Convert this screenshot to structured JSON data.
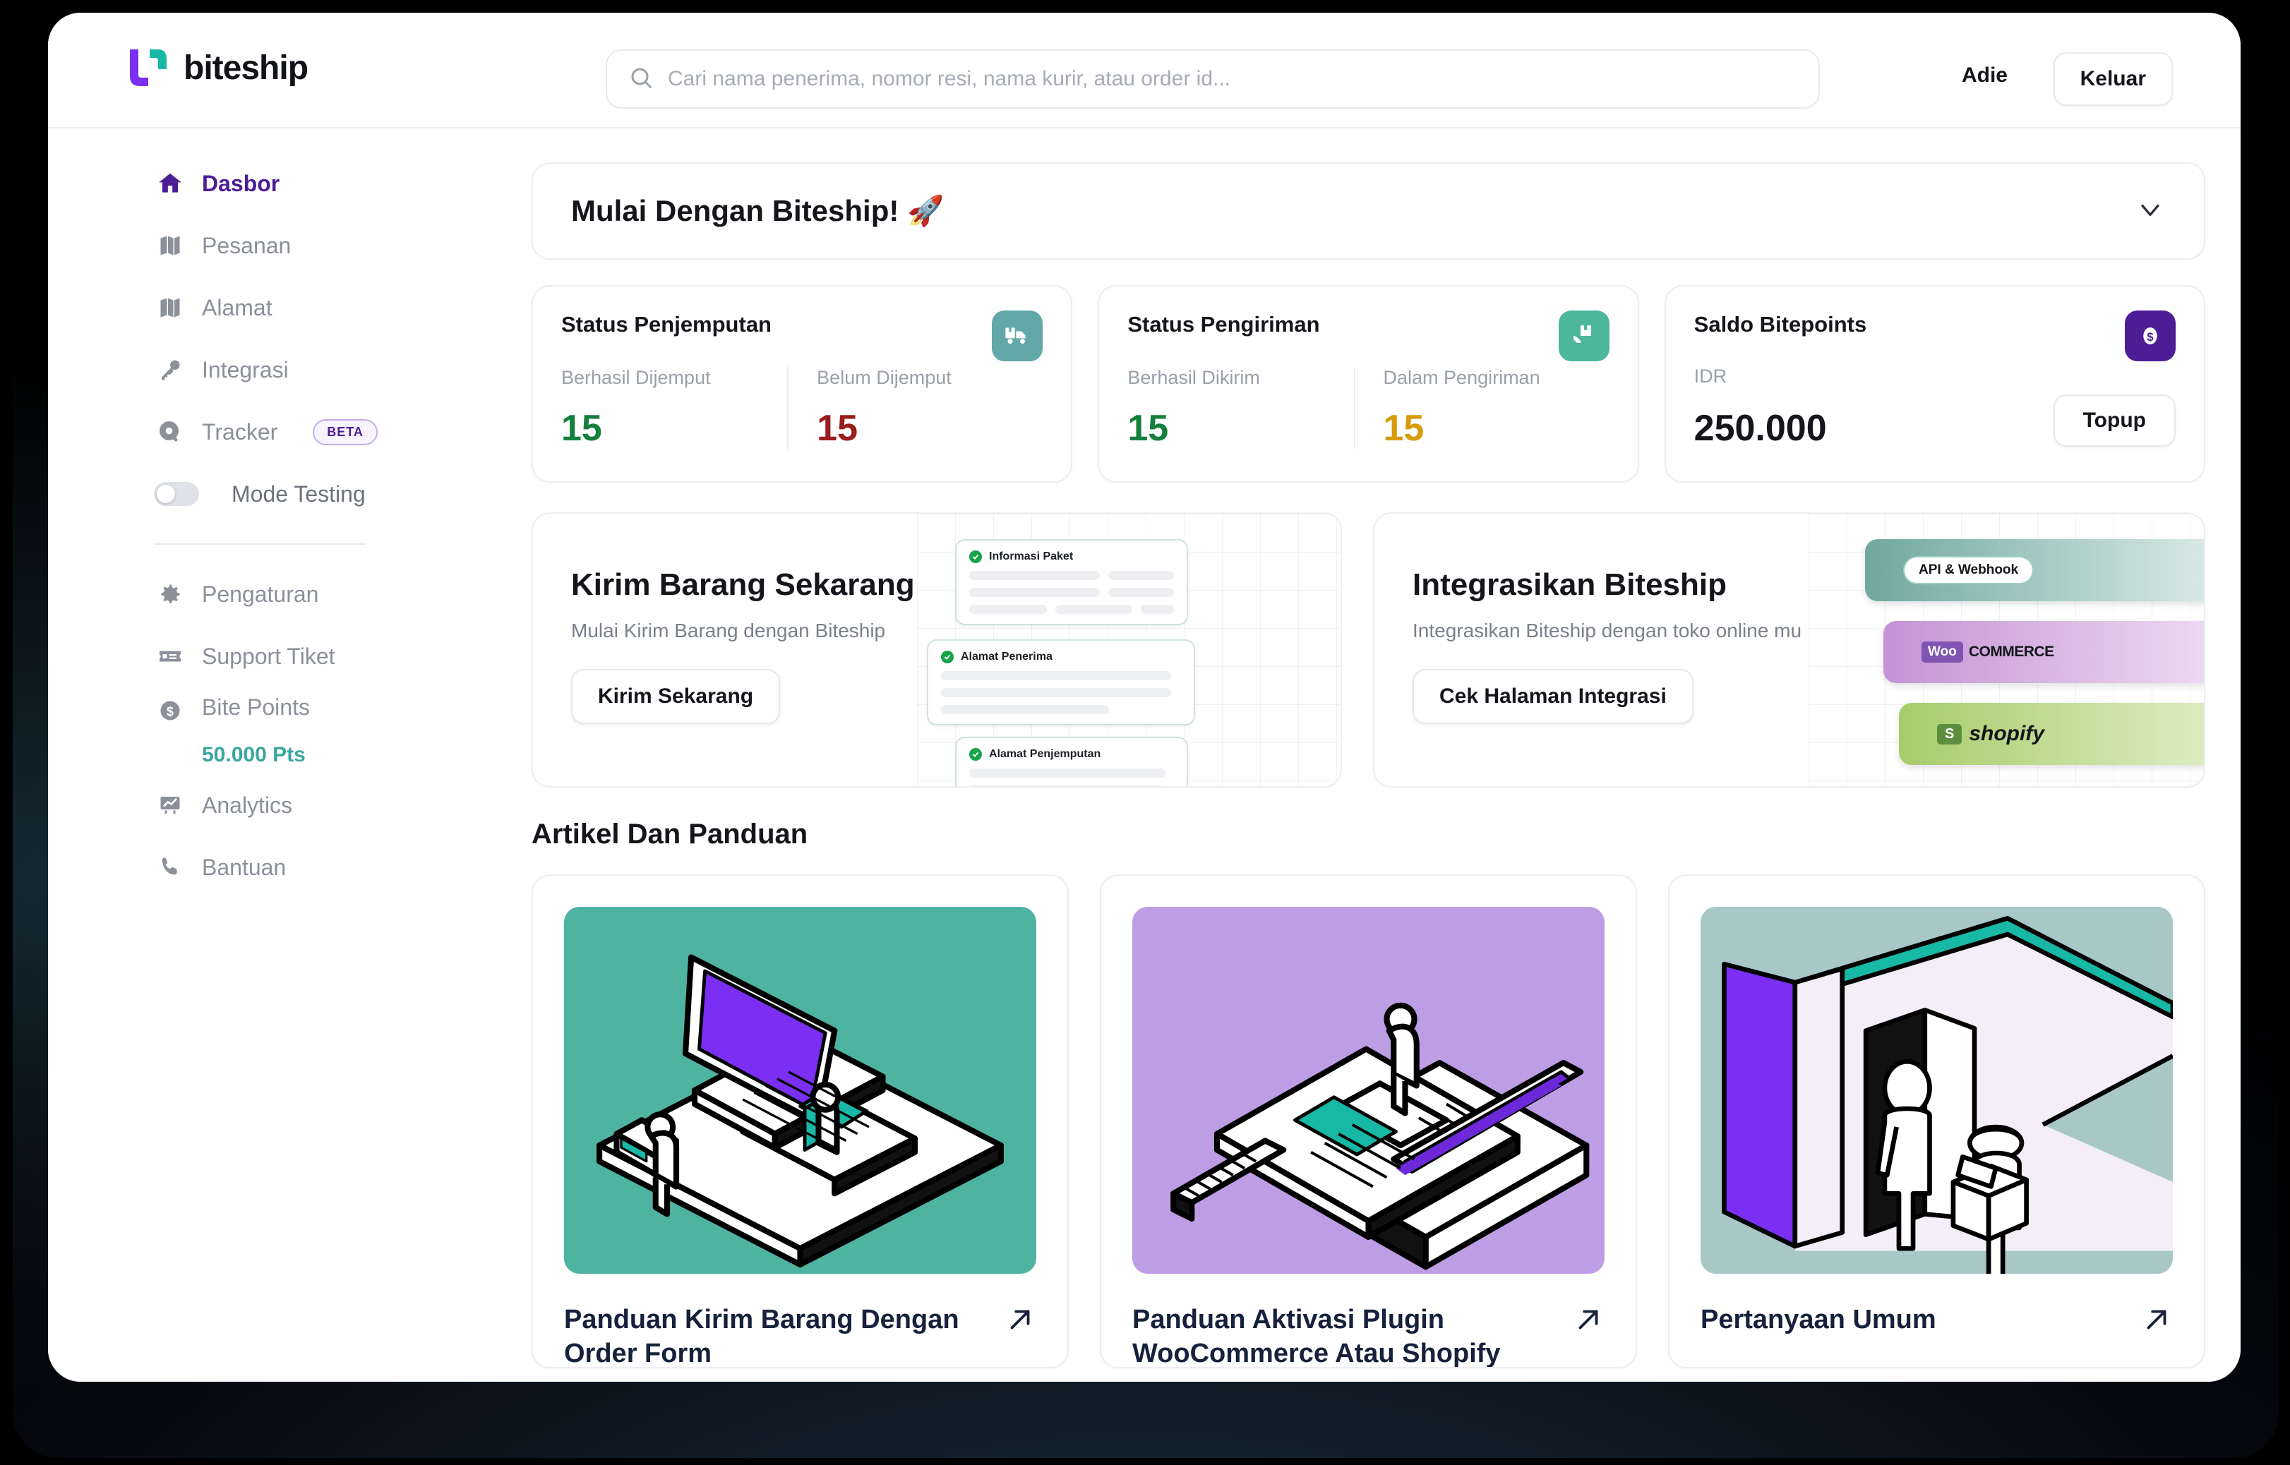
{
  "header": {
    "logo_text": "biteship",
    "logo_purple": "#7b2ff2",
    "logo_teal": "#17b8a6",
    "search_placeholder": "Cari nama penerima, nomor resi, nama kurir, atau order id...",
    "search_value": "",
    "user_name": "Adie",
    "logout_label": "Keluar"
  },
  "sidebar": {
    "items": [
      {
        "label": "Dasbor",
        "icon": "home-icon",
        "active": true
      },
      {
        "label": "Pesanan",
        "icon": "map-icon",
        "active": false
      },
      {
        "label": "Alamat",
        "icon": "map-icon",
        "active": false
      },
      {
        "label": "Integrasi",
        "icon": "key-icon",
        "active": false
      },
      {
        "label": "Tracker",
        "icon": "search-circle-icon",
        "active": false,
        "badge": "BETA"
      }
    ],
    "toggle": {
      "label": "Mode Testing",
      "state": "off"
    },
    "items2": [
      {
        "label": "Pengaturan",
        "icon": "gear-icon"
      },
      {
        "label": "Support Tiket",
        "icon": "ticket-icon"
      },
      {
        "label": "Bite Points",
        "icon": "money-icon",
        "sub": "50.000 Pts",
        "sub_color": "#3aa6a0"
      },
      {
        "label": "Analytics",
        "icon": "chart-icon"
      },
      {
        "label": "Bantuan",
        "icon": "phone-icon"
      }
    ]
  },
  "main": {
    "onboarding": {
      "title": "Mulai Dengan Biteship! 🚀",
      "chevron": "chevron-down-icon"
    },
    "stats": [
      {
        "title": "Status Penjemputan",
        "badge_icon": "truck-box-icon",
        "badge_color": "#62a8a8",
        "columns": [
          {
            "label": "Berhasil Dijemput",
            "value": "15",
            "color": "#15803d"
          },
          {
            "label": "Belum Dijemput",
            "value": "15",
            "color": "#9b1c1c"
          }
        ]
      },
      {
        "title": "Status Pengiriman",
        "badge_icon": "hand-package-icon",
        "badge_color": "#4cb79c",
        "columns": [
          {
            "label": "Berhasil Dikirim",
            "value": "15",
            "color": "#15803d"
          },
          {
            "label": "Dalam Pengiriman",
            "value": "15",
            "color": "#d79b0b"
          }
        ]
      }
    ],
    "balance": {
      "title": "Saldo Bitepoints",
      "badge_icon": "money-circle-icon",
      "badge_color": "#4c1d95",
      "currency": "IDR",
      "amount": "250.000",
      "topup_label": "Topup"
    },
    "promos": [
      {
        "title": "Kirim Barang Sekarang",
        "subtitle": "Mulai Kirim Barang dengan Biteship",
        "button": "Kirim Sekarang",
        "art_cards": [
          {
            "label": "Informasi Paket"
          },
          {
            "label": "Alamat Penerima"
          },
          {
            "label": "Alamat Penjemputan"
          }
        ]
      },
      {
        "title": "Integrasikan Biteship",
        "subtitle": "Integrasikan Biteship dengan toko online mu",
        "button": "Cek Halaman Integrasi",
        "pills": [
          {
            "label": "API & Webhook",
            "style": "chip",
            "color_from": "#6fa89e",
            "color_to": "#e9f3f0"
          },
          {
            "label": "WOO COMMERCE",
            "style": "woo",
            "color_from": "#c592d4",
            "color_to": "#f2e3f6"
          },
          {
            "label": "shopify",
            "style": "shopify",
            "color_from": "#a7cc6a",
            "color_to": "#e8f3d4"
          }
        ]
      }
    ],
    "articles_title": "Artikel Dan Panduan",
    "articles": [
      {
        "title": "Panduan Kirim Barang Dengan Order Form",
        "thumb": "laptop-teal-illustration",
        "bg": "#4fb3a1",
        "arrow": "arrow-up-right-icon"
      },
      {
        "title": "Panduan Aktivasi Plugin WooCommerce Atau Shopify",
        "thumb": "laptop-purple-illustration",
        "bg": "#bd9ee4",
        "arrow": "arrow-up-right-icon"
      },
      {
        "title": "Pertanyaan Umum",
        "thumb": "delivery-door-illustration",
        "bg": "#a8c8c8",
        "arrow": "arrow-up-right-icon"
      }
    ]
  }
}
